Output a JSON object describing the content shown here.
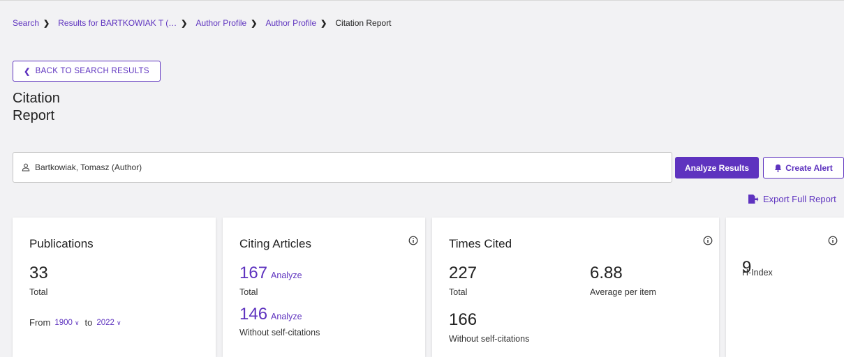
{
  "breadcrumb": {
    "items": [
      "Search",
      "Results for BARTKOWIAK T (…",
      "Author Profile",
      "Author Profile"
    ],
    "current": "Citation Report"
  },
  "back_button": {
    "label": "BACK TO SEARCH RESULTS"
  },
  "page": {
    "title": "Citation Report"
  },
  "search": {
    "query": "Bartkowiak, Tomasz (Author)"
  },
  "actions": {
    "analyze": "Analyze Results",
    "alert": "Create Alert",
    "export": "Export Full Report"
  },
  "cards": {
    "publications": {
      "title": "Publications",
      "total": "33",
      "total_label": "Total",
      "from_label": "From",
      "from_year": "1900",
      "to_label": "to",
      "to_year": "2022"
    },
    "citing": {
      "title": "Citing Articles",
      "total": "167",
      "analyze": "Analyze",
      "total_label": "Total",
      "without_self": "146",
      "without_self_label": "Without self-citations"
    },
    "times_cited": {
      "title": "Times Cited",
      "total": "227",
      "total_label": "Total",
      "avg": "6.88",
      "avg_label": "Average per item",
      "without_self": "166",
      "without_self_label": "Without self-citations"
    },
    "h_index": {
      "value": "9",
      "label": "H-Index"
    }
  },
  "colors": {
    "accent": "#5e33bf",
    "background": "#f2f2f4",
    "card": "#ffffff"
  }
}
